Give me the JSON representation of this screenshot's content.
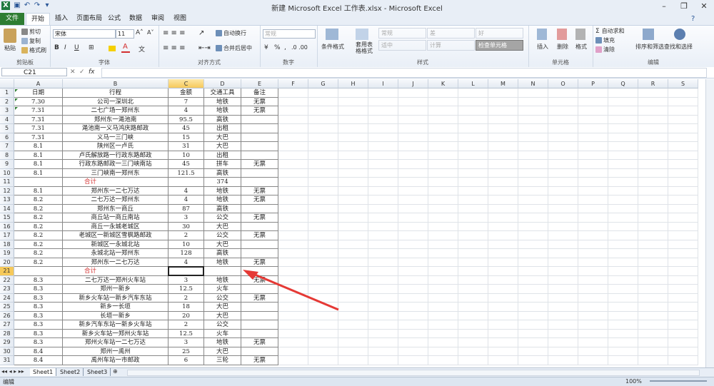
{
  "window": {
    "title": "新建 Microsoft Excel 工作表.xlsx - Microsoft Excel"
  },
  "tabs": [
    "文件",
    "开始",
    "插入",
    "页面布局",
    "公式",
    "数据",
    "审阅",
    "视图"
  ],
  "active_tab": "开始",
  "ribbon": {
    "clipboard": {
      "paste": "粘贴",
      "cut": "剪切",
      "copy": "复制",
      "format_painter": "格式刷",
      "label": "剪贴板"
    },
    "font": {
      "name": "宋体",
      "size": "11",
      "label": "字体",
      "bold": "B",
      "italic": "I",
      "underline": "U"
    },
    "alignment": {
      "wrap": "自动换行",
      "merge": "合并后居中",
      "label": "对齐方式"
    },
    "number": {
      "format": "常规",
      "label": "数字",
      "percent": "%",
      "comma": ","
    },
    "styles": {
      "cond_format": "条件格式",
      "table_format": "套用表格格式",
      "normal": "常规",
      "bad": "差",
      "good": "好",
      "neutral": "适中",
      "calc": "计算",
      "check": "检查单元格",
      "label": "样式"
    },
    "cells": {
      "insert": "插入",
      "delete": "删除",
      "format": "格式",
      "label": "单元格"
    },
    "editing": {
      "autosum": "自动求和",
      "fill": "填充",
      "clear": "清除",
      "sort": "排序和筛选",
      "find": "查找和选择",
      "label": "编辑"
    }
  },
  "formula_bar": {
    "cell_ref": "C21",
    "fx": "fx",
    "value": ""
  },
  "columns": [
    "A",
    "B",
    "C",
    "D",
    "E",
    "F",
    "G",
    "H",
    "I",
    "J",
    "K",
    "L",
    "M",
    "N",
    "O",
    "P",
    "Q",
    "R",
    "S"
  ],
  "selected_column": "C",
  "selected_row": "21",
  "rows": [
    {
      "n": "1",
      "a": "日期",
      "b": "行程",
      "c": "金额",
      "d": "交通工具",
      "e": "备注"
    },
    {
      "n": "2",
      "a": "7.30",
      "b": "公司一深圳北",
      "c": "7",
      "d": "地铁",
      "e": "无票"
    },
    {
      "n": "3",
      "a": "7.31",
      "b": "二七广场一郑州东",
      "c": "4",
      "d": "地铁",
      "e": "无票"
    },
    {
      "n": "4",
      "a": "7.31",
      "b": "郑州东一渑池南",
      "c": "95.5",
      "d": "高铁",
      "e": ""
    },
    {
      "n": "5",
      "a": "7.31",
      "b": "渑池南一义马鸿庆路邮政",
      "c": "45",
      "d": "出租",
      "e": ""
    },
    {
      "n": "6",
      "a": "7.31",
      "b": "义马一三门峡",
      "c": "15",
      "d": "大巴",
      "e": ""
    },
    {
      "n": "7",
      "a": "8.1",
      "b": "陕州区一卢氏",
      "c": "31",
      "d": "大巴",
      "e": ""
    },
    {
      "n": "8",
      "a": "8.1",
      "b": "卢氏解放路一行政东路邮政",
      "c": "10",
      "d": "出租",
      "e": ""
    },
    {
      "n": "9",
      "a": "8.1",
      "b": "行政东路邮政一三门峡南站",
      "c": "45",
      "d": "拼车",
      "e": "无票"
    },
    {
      "n": "10",
      "a": "8.1",
      "b": "三门峡南一郑州东",
      "c": "121.5",
      "d": "高铁",
      "e": ""
    },
    {
      "n": "11",
      "a": "",
      "b": "合计",
      "c": "",
      "d": "374",
      "e": "",
      "total": true
    },
    {
      "n": "12",
      "a": "8.1",
      "b": "郑州东一二七万达",
      "c": "4",
      "d": "地铁",
      "e": "无票"
    },
    {
      "n": "13",
      "a": "8.2",
      "b": "二七万达一郑州东",
      "c": "4",
      "d": "地铁",
      "e": "无票"
    },
    {
      "n": "14",
      "a": "8.2",
      "b": "郑州东一商丘",
      "c": "87",
      "d": "高铁",
      "e": ""
    },
    {
      "n": "15",
      "a": "8.2",
      "b": "商丘站一商丘南站",
      "c": "3",
      "d": "公交",
      "e": "无票"
    },
    {
      "n": "16",
      "a": "8.2",
      "b": "商丘一永城老城区",
      "c": "30",
      "d": "大巴",
      "e": ""
    },
    {
      "n": "17",
      "a": "8.2",
      "b": "老城区一新城区雪枫路邮政",
      "c": "2",
      "d": "公交",
      "e": "无票"
    },
    {
      "n": "18",
      "a": "8.2",
      "b": "新城区一永城北站",
      "c": "10",
      "d": "大巴",
      "e": ""
    },
    {
      "n": "19",
      "a": "8.2",
      "b": "永城北站一郑州东",
      "c": "128",
      "d": "高铁",
      "e": ""
    },
    {
      "n": "20",
      "a": "8.2",
      "b": "郑州东一二七万达",
      "c": "4",
      "d": "地铁",
      "e": "无票"
    },
    {
      "n": "21",
      "a": "",
      "b": "合计",
      "c": "",
      "d": "",
      "e": "",
      "total": true
    },
    {
      "n": "22",
      "a": "8.3",
      "b": "二七万达一郑州火车站",
      "c": "3",
      "d": "地铁",
      "e": "无票"
    },
    {
      "n": "23",
      "a": "8.3",
      "b": "郑州一新乡",
      "c": "12.5",
      "d": "火车",
      "e": ""
    },
    {
      "n": "24",
      "a": "8.3",
      "b": "新乡火车站一新乡汽车东站",
      "c": "2",
      "d": "公交",
      "e": "无票"
    },
    {
      "n": "25",
      "a": "8.3",
      "b": "新乡一长垣",
      "c": "18",
      "d": "大巴",
      "e": ""
    },
    {
      "n": "26",
      "a": "8.3",
      "b": "长垣一新乡",
      "c": "20",
      "d": "大巴",
      "e": ""
    },
    {
      "n": "27",
      "a": "8.3",
      "b": "新乡汽车东站一新乡火车站",
      "c": "2",
      "d": "公交",
      "e": ""
    },
    {
      "n": "28",
      "a": "8.3",
      "b": "新乡火车站一郑州火车站",
      "c": "12.5",
      "d": "火车",
      "e": ""
    },
    {
      "n": "29",
      "a": "8.3",
      "b": "郑州火车站一二七万达",
      "c": "3",
      "d": "地铁",
      "e": "无票"
    },
    {
      "n": "30",
      "a": "8.4",
      "b": "郑州一禹州",
      "c": "25",
      "d": "大巴",
      "e": ""
    },
    {
      "n": "31",
      "a": "8.4",
      "b": "禹州车站一市邮政",
      "c": "6",
      "d": "三轮",
      "e": "无票"
    }
  ],
  "sheets": [
    "Sheet1",
    "Sheet2",
    "Sheet3"
  ],
  "active_sheet": "Sheet1",
  "status": {
    "mode": "编辑",
    "zoom": "100%"
  },
  "colors": {
    "file_tab": "#2e7d32",
    "total_text": "#d32f2f",
    "arrow": "#e53935",
    "select": "#f6c95a"
  }
}
